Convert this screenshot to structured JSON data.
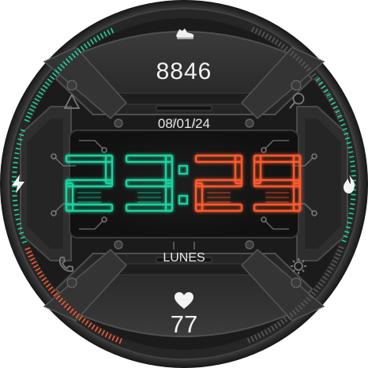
{
  "watchface": {
    "steps": "8846",
    "date": "08/01/24",
    "day": "LUNES",
    "heart_rate": "77",
    "time": {
      "hours_digits": [
        "2",
        "3"
      ],
      "minutes_digits": [
        "2",
        "9"
      ],
      "separator": ":"
    },
    "colors": {
      "hours_accent": "#1fd3a0",
      "minutes_accent": "#ff5a2e",
      "steps_ring": "#1fd3a0",
      "heart_ring": "#ff5a2e",
      "bezel": "#1a1a1a",
      "panel": "#2c2c2c"
    },
    "icons": {
      "top": "shoe-icon",
      "left": "lightning-icon",
      "right": "flame-icon",
      "bottom": "heart-icon",
      "upper_left": "triangle-icon",
      "upper_right": "magnifier-icon",
      "lower_left": "phone-icon",
      "lower_right": "gear-icon"
    }
  }
}
